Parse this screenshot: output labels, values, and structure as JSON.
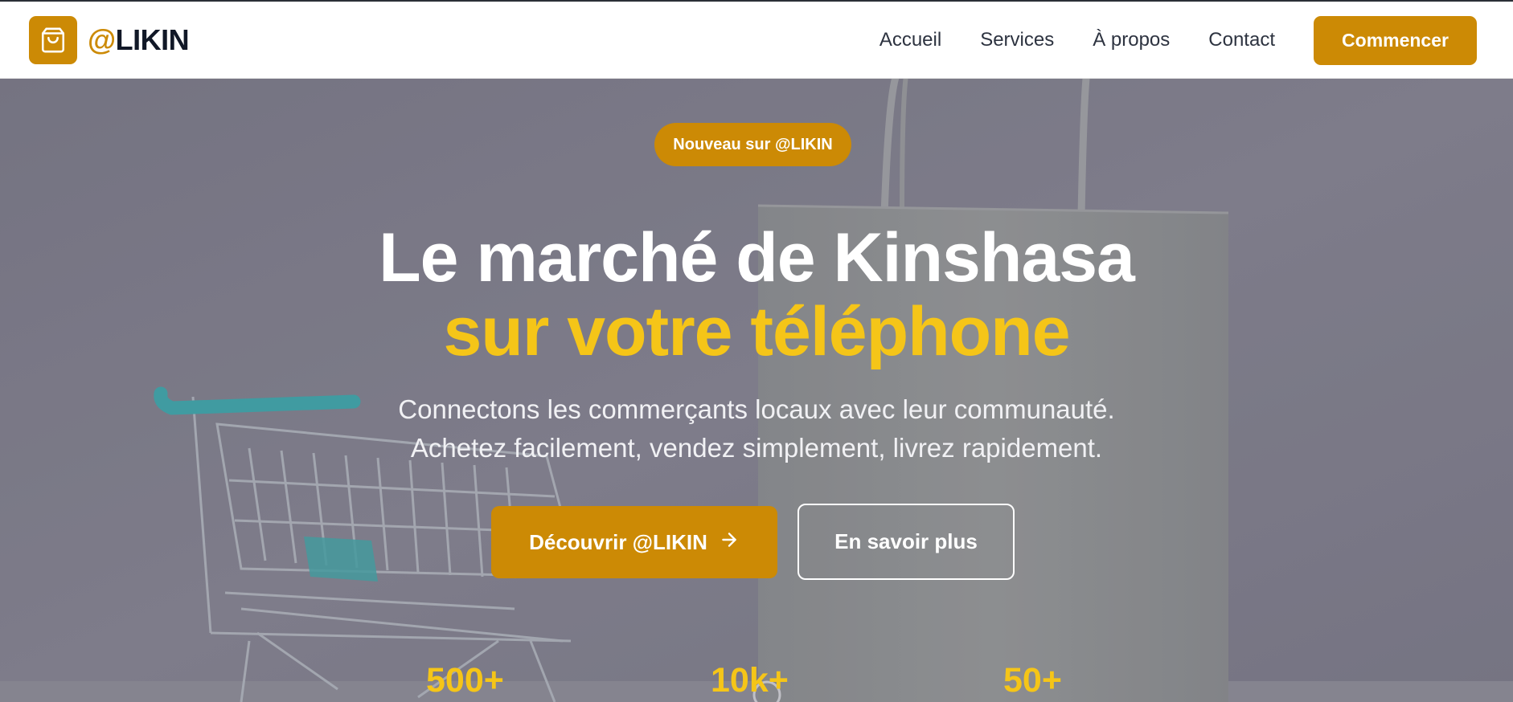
{
  "brand": {
    "at": "@",
    "name": "LIKIN",
    "color": "#cc8a05",
    "icon": "shopping-bag-icon"
  },
  "nav": {
    "items": [
      {
        "label": "Accueil"
      },
      {
        "label": "Services"
      },
      {
        "label": "À propos"
      },
      {
        "label": "Contact"
      }
    ],
    "cta_label": "Commencer"
  },
  "hero": {
    "badge": "Nouveau sur @LIKIN",
    "title_line1": "Le marché de Kinshasa",
    "title_line2": "sur votre téléphone",
    "subtitle_line1": "Connectons les commerçants locaux avec leur communauté.",
    "subtitle_line2": "Achetez facilement, vendez simplement, livrez rapidement.",
    "primary_button": "Découvrir @LIKIN",
    "primary_icon": "arrow-right-icon",
    "secondary_button": "En savoir plus",
    "accent_color": "#f5c518",
    "background": "shopping-cart-and-paper-bag-photo"
  },
  "stats": [
    {
      "value": "500+"
    },
    {
      "value": "10k+"
    },
    {
      "value": "50+"
    }
  ]
}
